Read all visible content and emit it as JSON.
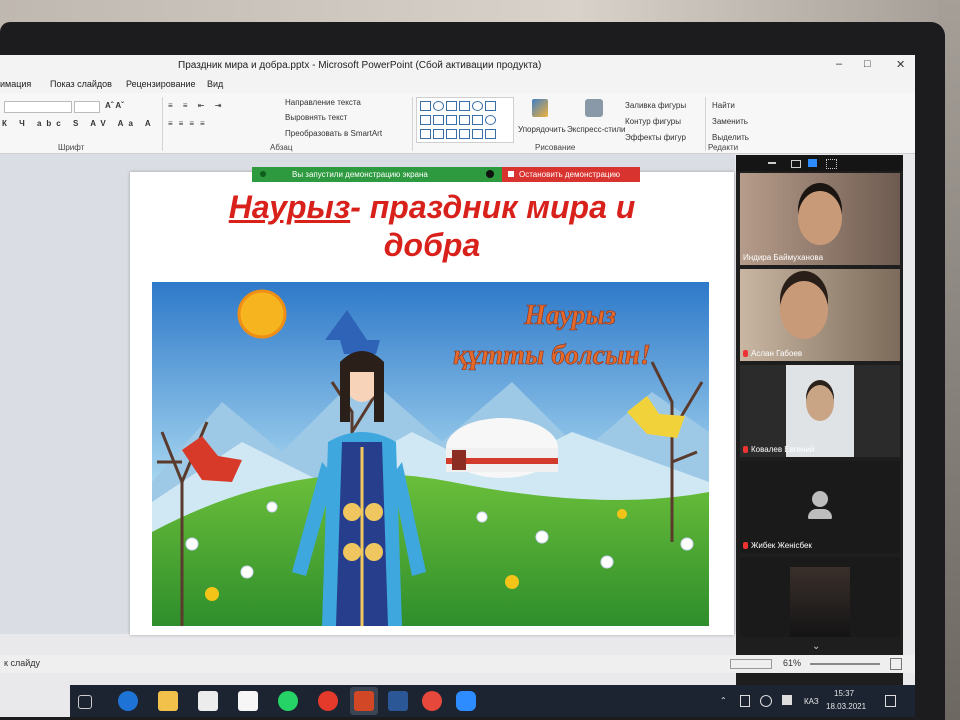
{
  "window": {
    "title": "Праздник мира и добра.pptx - Microsoft PowerPoint (Сбой активации продукта)"
  },
  "menu": [
    "имация",
    "Показ слайдов",
    "Рецензирование",
    "Вид"
  ],
  "ribbon": {
    "font_group": "Шрифт",
    "paragraph_group": "Абзац",
    "drawing_group": "Рисование",
    "editing_group": "Редакти",
    "text_direction": "Направление текста",
    "align_text": "Выровнять текст",
    "convert_smartart": "Преобразовать в SmartArt",
    "arrange": "Упорядочить",
    "quick_styles": "Экспресс-стили",
    "shape_fill": "Заливка фигуры",
    "shape_outline": "Контур фигуры",
    "shape_effects": "Эффекты фигур",
    "find": "Найти",
    "replace": "Заменить",
    "select": "Выделить"
  },
  "sharing": {
    "status": "Вы запустили демонстрацию экрана",
    "stop": "Остановить демонстрацию"
  },
  "slide": {
    "title_part1": "Наурыз",
    "title_part2": "- праздник мира и",
    "title_line2": "добра",
    "card_text_line1": "Наурыз",
    "card_text_line2": "құтты болсын!"
  },
  "participants": [
    {
      "name": "Индира Баймуханова",
      "muted": false
    },
    {
      "name": "Аслан Габоев",
      "muted": true
    },
    {
      "name": "Ковалев Евгений",
      "muted": true
    },
    {
      "name": "Жибек Женісбек",
      "muted": true
    },
    {
      "name": "",
      "muted": false
    }
  ],
  "statusbar": {
    "left_text": "к слайду",
    "zoom": "61%"
  },
  "tray": {
    "lang": "КАЗ",
    "time": "15:37",
    "date": "18.03.2021"
  }
}
